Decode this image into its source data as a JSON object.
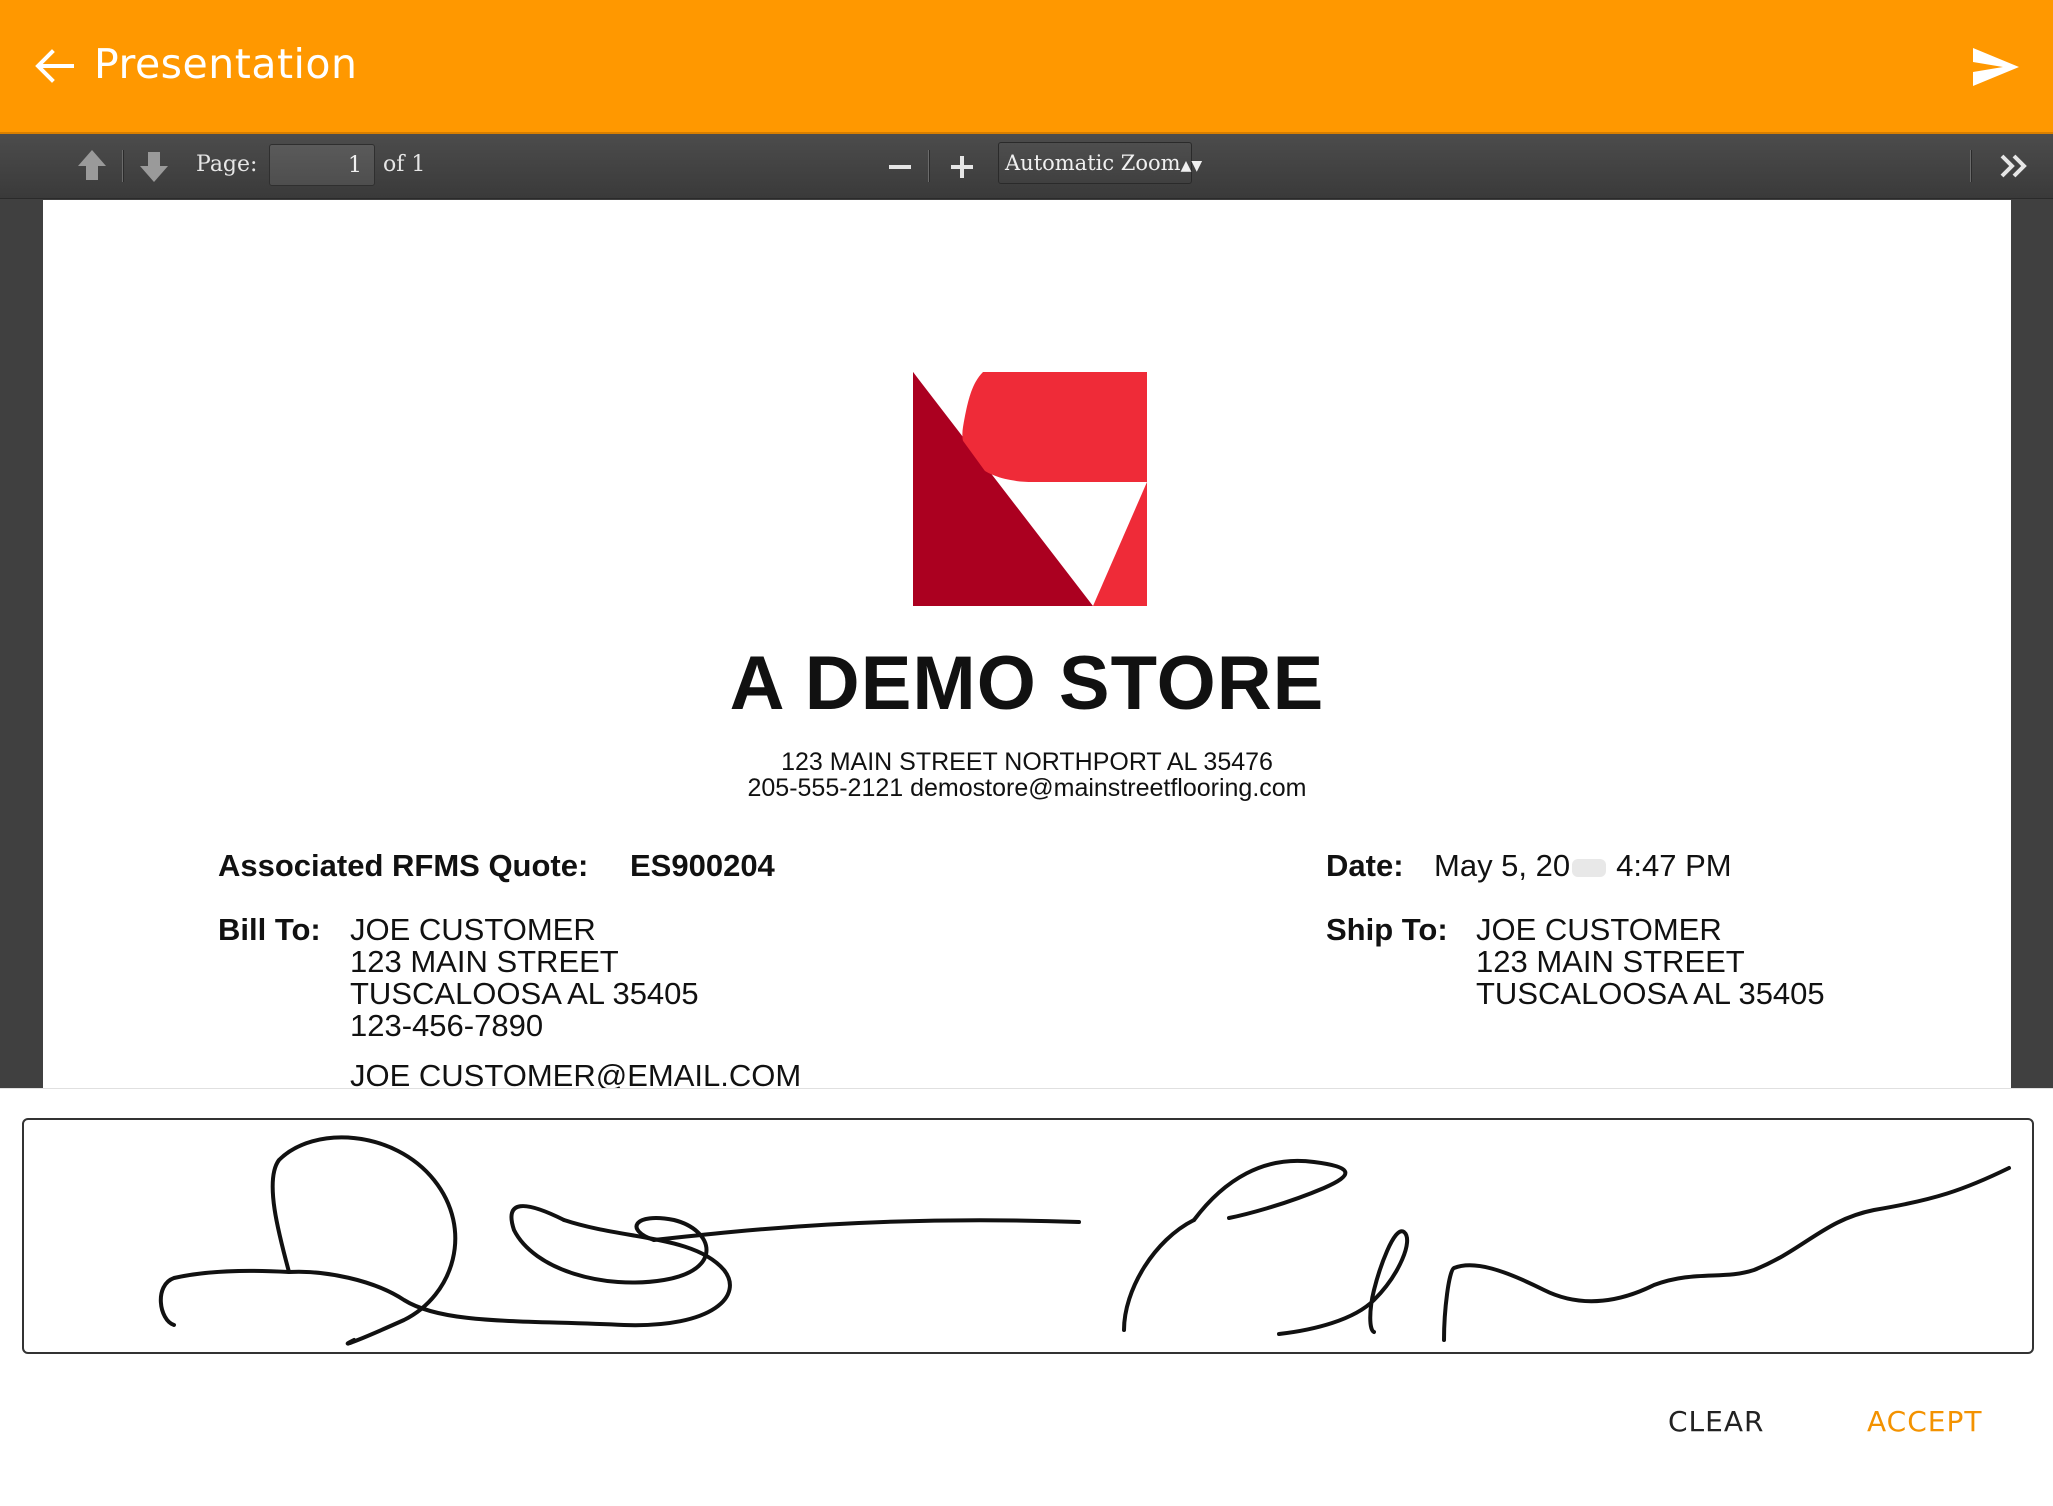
{
  "appbar": {
    "title": "Presentation",
    "back_icon": "arrow-back-icon",
    "send_icon": "send-icon",
    "background_color": "#ff9800"
  },
  "viewer_toolbar": {
    "page_label": "Page:",
    "page_value": "1",
    "page_total": "of 1",
    "zoom_value": "Automatic Zoom",
    "icons": [
      "arrow-up-icon",
      "arrow-down-icon",
      "zoom-out-icon",
      "zoom-in-icon",
      "double-chevron-right-icon"
    ]
  },
  "document": {
    "logo_icon": "store-logo",
    "store_name": "A DEMO STORE",
    "address_line": "123 MAIN STREET NORTHPORT AL 35476",
    "contact_line": "205-555-2121 demostore@mainstreetflooring.com",
    "quote_label": "Associated RFMS Quote:",
    "quote_value": "ES900204",
    "date_label": "Date:",
    "date_value": "May 5, 20",
    "time_value": "4:47 PM",
    "bill_to": {
      "label": "Bill To:",
      "lines": [
        "JOE CUSTOMER",
        "123 MAIN STREET",
        "TUSCALOOSA AL 35405",
        "123-456-7890",
        "JOE CUSTOMER@EMAIL.COM"
      ]
    },
    "ship_to": {
      "label": "Ship To:",
      "lines": [
        "JOE CUSTOMER",
        "123 MAIN STREET",
        "TUSCALOOSA AL 35405"
      ]
    }
  },
  "signature": {
    "clear_label": "CLEAR",
    "accept_label": "ACCEPT",
    "accent_color": "#f39200"
  }
}
